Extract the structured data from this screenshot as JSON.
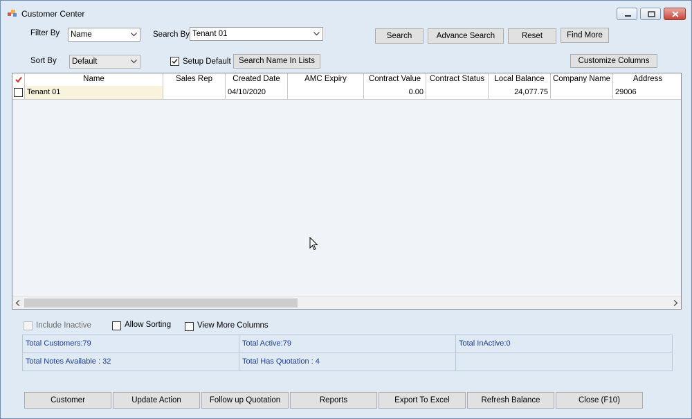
{
  "window": {
    "title": "Customer Center"
  },
  "filters": {
    "filter_by_label": "Filter By",
    "filter_by_value": "Name",
    "search_by_label": "Search By",
    "search_by_value": "Tenant 01",
    "sort_by_label": "Sort By",
    "sort_by_value": "Default",
    "setup_default_label": "Setup Default",
    "setup_default_checked": true
  },
  "buttons": {
    "search": "Search",
    "advance_search": "Advance Search",
    "reset": "Reset",
    "find_more": "Find More",
    "search_name_in_lists": "Search Name In Lists",
    "customize_columns": "Customize Columns"
  },
  "grid": {
    "columns": [
      "Name",
      "Sales Rep",
      "Created Date",
      "AMC Expiry",
      "Contract Value",
      "Contract Status",
      "Local Balance",
      "Company Name",
      "Address"
    ],
    "rows": [
      {
        "checked": false,
        "cells": [
          "Tenant 01",
          "",
          "04/10/2020",
          "",
          "0.00",
          "",
          "24,077.75",
          "",
          "29006"
        ]
      }
    ]
  },
  "options": {
    "include_inactive": "Include Inactive",
    "allow_sorting": "Allow Sorting",
    "view_more_columns": "View More Columns"
  },
  "stats": {
    "total_customers": "Total Customers:79",
    "total_active": "Total Active:79",
    "total_inactive": "Total InActive:0",
    "total_notes": "Total Notes Available : 32",
    "total_quotation": "Total Has Quotation : 4"
  },
  "bottom_buttons": {
    "customer": "Customer",
    "update_action": "Update Action",
    "follow_up_quotation": "Follow up Quotation",
    "reports": "Reports",
    "export_to_excel": "Export To Excel",
    "refresh_balance": "Refresh Balance",
    "close": "Close (F10)"
  },
  "colors": {
    "window_bg": "#dfeaf5",
    "stats_text": "#1a3a9e",
    "close_button": "#c8453a"
  }
}
